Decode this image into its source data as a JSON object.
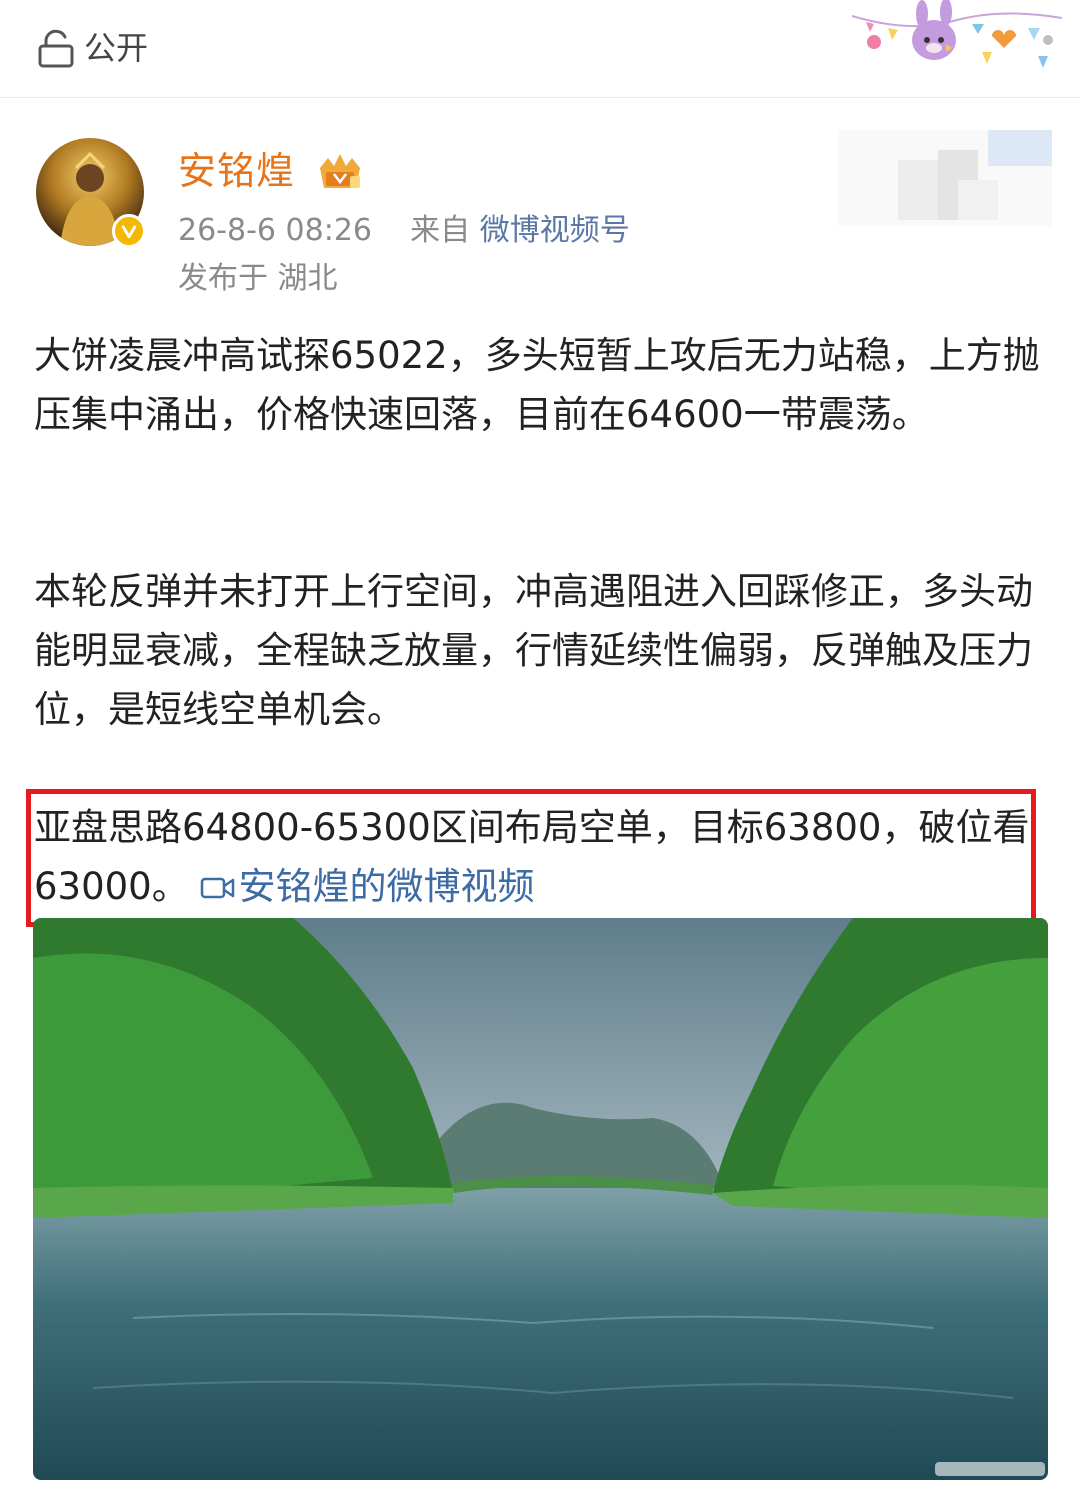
{
  "topbar": {
    "privacy_label": "公开",
    "icon": "lock-icon"
  },
  "post": {
    "username": "安铭煌",
    "timestamp": "26-8-6 08:26",
    "source_prefix": "来自",
    "source": "微博视频号",
    "location": "发布于 湖北",
    "paragraphs": [
      "大饼凌晨冲高试探65022，多头短暂上攻后无力站稳，上方抛压集中涌出，价格快速回落，目前在64600一带震荡。",
      "本轮反弹并未打开上行空间，冲高遇阻进入回踩修正，多头动能明显衰减，全程缺乏放量，行情延续性偏弱，反弹触及压力位，是短线空单机会。"
    ],
    "highlighted_paragraph": "亚盘思路64800-65300区间布局空单，目标63800，破位看63000。",
    "video_link": "安铭煌的微博视频"
  },
  "colors": {
    "username": "#e8741a",
    "link": "#3d6ba6",
    "highlight_border": "#e5191e",
    "meta": "#8a8a8a"
  }
}
